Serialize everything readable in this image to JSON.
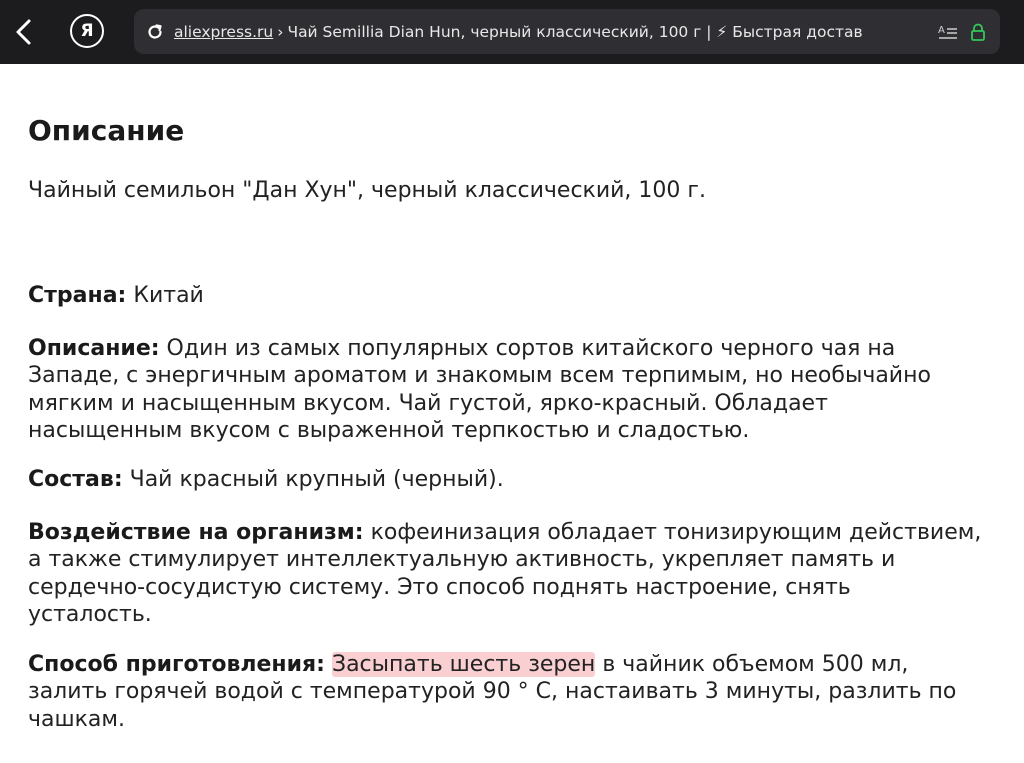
{
  "browser": {
    "url_domain": "aliexpress.ru",
    "url_separator": "›",
    "url_rest": "Чай Semillia Dian Hun, черный классический, 100 г | ⚡ Быстрая достав",
    "logo_letter": "Я"
  },
  "page": {
    "heading": "Описание",
    "subtitle": "Чайный семильон \"Дан Хун\", черный классический, 100 г.",
    "country": {
      "label": "Страна:",
      "value": " Китай"
    },
    "description": {
      "label": "Описание:",
      "line1": " Один из самых популярных сортов китайского черного чая на",
      "line2": "Западе, с энергичным ароматом и знакомым всем терпимым, но необычайно",
      "line3": "мягким и насыщенным вкусом. Чай густой, ярко-красный. Обладает",
      "line4": "насыщенным вкусом с выраженной терпкостью и сладостью."
    },
    "composition": {
      "label": "Состав:",
      "value": " Чай красный крупный (черный)."
    },
    "effect": {
      "label": "Воздействие на организм:",
      "line1": " кофеинизация обладает тонизирующим действием,",
      "line2": "а также стимулирует интеллектуальную активность, укрепляет память и",
      "line3": "сердечно-сосудистую систему. Это способ поднять настроение, снять",
      "line4": "усталость."
    },
    "preparation": {
      "label": "Способ приготовления:",
      "highlight": "Засыпать шесть зерен",
      "line1_rest": " в чайник объемом 500 мл,",
      "line2": "залить горячей водой с температурой 90 ° С, настаивать 3 минуты, разлить по",
      "line3": "чашкам."
    }
  },
  "colors": {
    "toolbar_bg": "#1c1c1e",
    "urlbar_bg": "#2f2f33",
    "lock_green": "#34c759",
    "highlight": "#f9cfd2"
  }
}
